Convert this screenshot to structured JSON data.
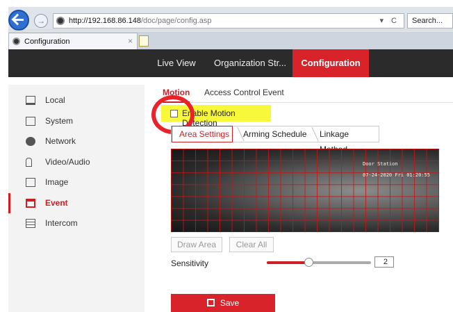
{
  "browser": {
    "url_host": "http://192.168.86.148",
    "url_path": "/doc/page/config.asp",
    "url_tools": "▾ C",
    "search_placeholder": "Search...",
    "tab_title": "Configuration",
    "tab_close": "×"
  },
  "topnav": {
    "live_view": "Live View",
    "organization": "Organization Str...",
    "configuration": "Configuration"
  },
  "sidebar": {
    "items": [
      {
        "label": "Local",
        "icon": "monitor-icon"
      },
      {
        "label": "System",
        "icon": "system-icon"
      },
      {
        "label": "Network",
        "icon": "globe-icon"
      },
      {
        "label": "Video/Audio",
        "icon": "microphone-icon"
      },
      {
        "label": "Image",
        "icon": "image-icon"
      },
      {
        "label": "Event",
        "icon": "calendar-icon",
        "active": true
      },
      {
        "label": "Intercom",
        "icon": "intercom-icon"
      }
    ]
  },
  "subtabs": {
    "motion": "Motion",
    "access_control": "Access Control Event"
  },
  "motion": {
    "enable_label": "Enable Motion Detection",
    "enabled": false,
    "steps": {
      "area": "Area Settings",
      "arming": "Arming Schedule",
      "linkage": "Linkage Method"
    },
    "video_overlay": {
      "name": "Door Station",
      "time": "07-24-2020 Fri 01:20:55"
    },
    "draw_area": "Draw Area",
    "clear_all": "Clear All",
    "sensitivity_label": "Sensitivity",
    "sensitivity_value": "2",
    "sensitivity_fraction": 0.4,
    "save": "Save"
  },
  "colors": {
    "accent": "#d8232a",
    "highlight": "#f7f83a",
    "nav_bg": "#2b2b2b"
  }
}
